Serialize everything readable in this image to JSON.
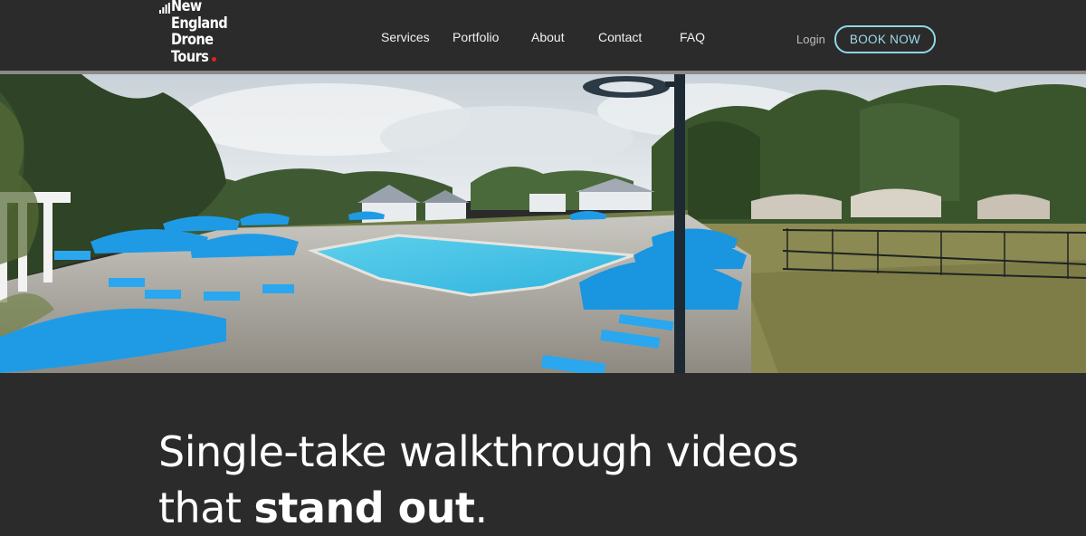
{
  "brand": {
    "logo_lines": [
      "New",
      "England",
      "Drone",
      "Tours"
    ],
    "accent_color": "#d9261c"
  },
  "nav": {
    "items": [
      {
        "label": "Services"
      },
      {
        "label": "Portfolio"
      },
      {
        "label": "About"
      },
      {
        "label": "Contact"
      },
      {
        "label": "FAQ"
      }
    ],
    "login_label": "Login",
    "cta_label": "BOOK NOW",
    "cta_color": "#8fd6e6"
  },
  "hero": {
    "image_alt_icon": "drone-pool-scene-image",
    "headline_line1": "Single-take walkthrough videos",
    "headline_line2_prefix": "that ",
    "headline_line2_emphasis": "stand out",
    "headline_line2_suffix": "."
  }
}
